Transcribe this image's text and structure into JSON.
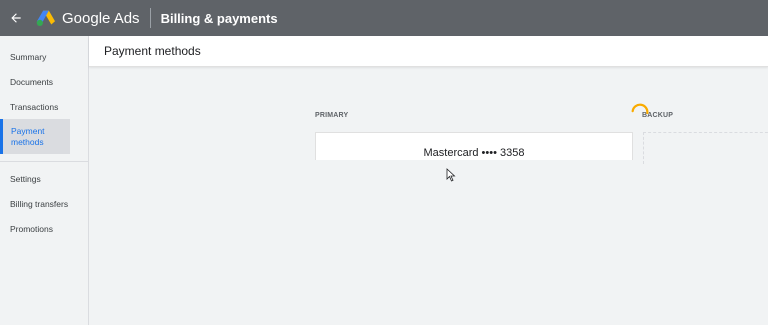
{
  "topbar": {
    "back_icon": "arrow-left-icon",
    "brand": "Google Ads",
    "section": "Billing & payments"
  },
  "sidebar": {
    "items": [
      {
        "label": "Summary"
      },
      {
        "label": "Documents"
      },
      {
        "label": "Transactions"
      },
      {
        "label": "Payment methods",
        "active": true
      },
      {
        "label": "Settings"
      },
      {
        "label": "Billing transfers"
      },
      {
        "label": "Promotions"
      }
    ]
  },
  "main": {
    "title": "Payment methods",
    "primary_label": "PRIMARY",
    "backup_label": "BACKUP",
    "primary_card": "Mastercard •••• 3358"
  },
  "colors": {
    "topbar": "#5f6368",
    "accent": "#1a73e8",
    "spinner": "#f9ab00"
  }
}
